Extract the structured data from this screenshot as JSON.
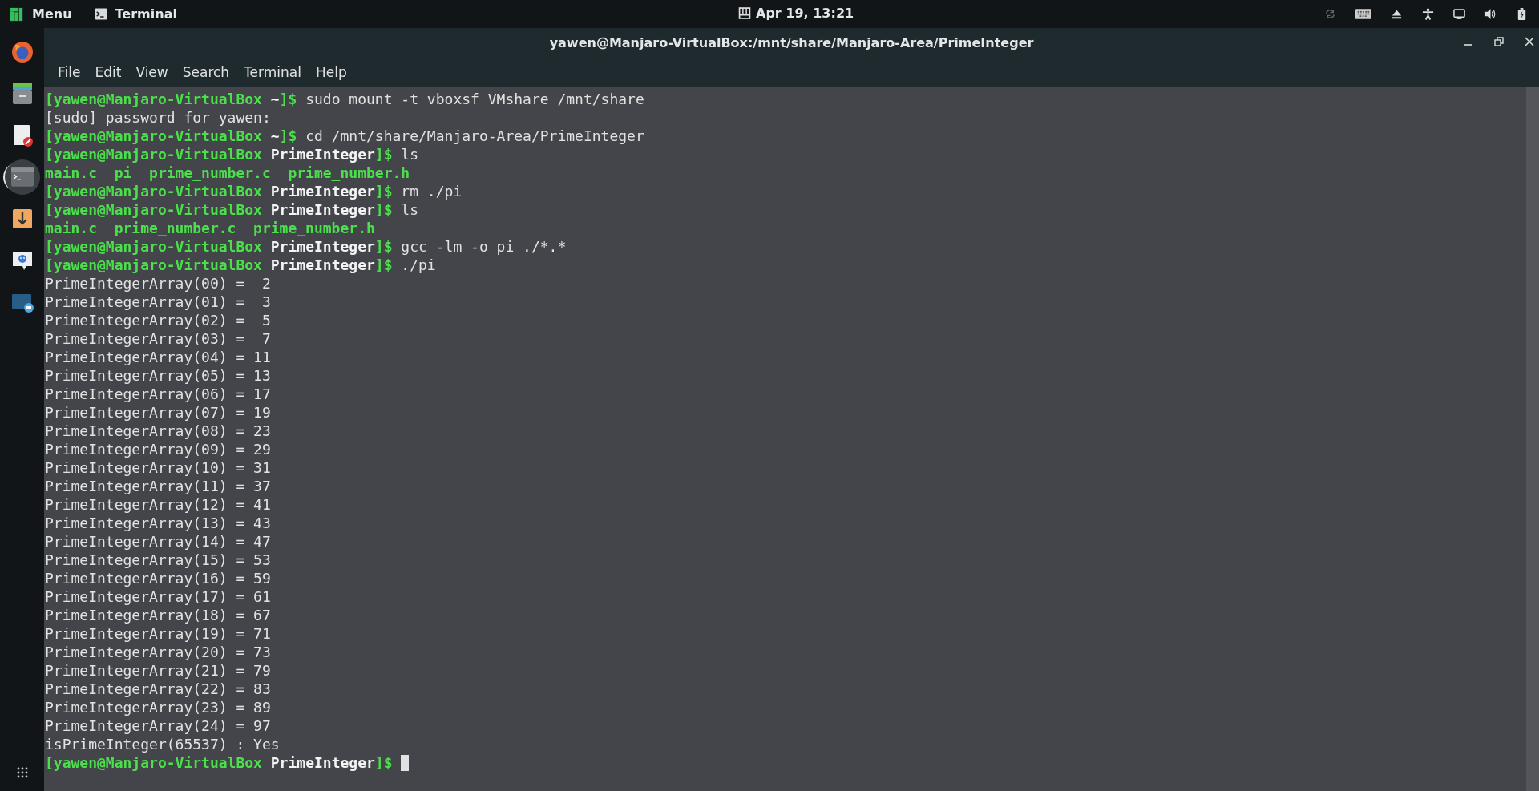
{
  "top_bar": {
    "menu_label": "Menu",
    "app_label": "Terminal",
    "clock": "Apr 19, 13:21"
  },
  "dock": {
    "items": [
      {
        "kind": "browser",
        "selected": false
      },
      {
        "kind": "files",
        "selected": false
      },
      {
        "kind": "editor",
        "selected": false
      },
      {
        "kind": "terminal",
        "selected": true
      },
      {
        "kind": "download",
        "selected": false
      },
      {
        "kind": "chat",
        "selected": false
      },
      {
        "kind": "screenshot",
        "selected": false
      }
    ]
  },
  "window": {
    "title": "yawen@Manjaro-VirtualBox:/mnt/share/Manjaro-Area/PrimeInteger"
  },
  "menu_bar": [
    "File",
    "Edit",
    "View",
    "Search",
    "Terminal",
    "Help"
  ],
  "terminal": {
    "lines": [
      {
        "kind": "prompt",
        "user": "[yawen@Manjaro-VirtualBox",
        "dir": "~",
        "end": "]$",
        "command": "sudo mount -t vboxsf VMshare /mnt/share"
      },
      {
        "kind": "plain",
        "text": "[sudo] password for yawen:"
      },
      {
        "kind": "prompt",
        "user": "[yawen@Manjaro-VirtualBox",
        "dir": "~",
        "end": "]$",
        "command": "cd /mnt/share/Manjaro-Area/PrimeInteger"
      },
      {
        "kind": "prompt",
        "user": "[yawen@Manjaro-VirtualBox",
        "dir": "PrimeInteger",
        "end": "]$",
        "command": "ls"
      },
      {
        "kind": "listing",
        "text": "main.c  pi  prime_number.c  prime_number.h"
      },
      {
        "kind": "prompt",
        "user": "[yawen@Manjaro-VirtualBox",
        "dir": "PrimeInteger",
        "end": "]$",
        "command": "rm ./pi"
      },
      {
        "kind": "prompt",
        "user": "[yawen@Manjaro-VirtualBox",
        "dir": "PrimeInteger",
        "end": "]$",
        "command": "ls"
      },
      {
        "kind": "listing",
        "text": "main.c  prime_number.c  prime_number.h"
      },
      {
        "kind": "prompt",
        "user": "[yawen@Manjaro-VirtualBox",
        "dir": "PrimeInteger",
        "end": "]$",
        "command": "gcc -lm -o pi ./*.*"
      },
      {
        "kind": "prompt",
        "user": "[yawen@Manjaro-VirtualBox",
        "dir": "PrimeInteger",
        "end": "]$",
        "command": "./pi"
      },
      {
        "kind": "plain",
        "text": "PrimeIntegerArray(00) =  2"
      },
      {
        "kind": "plain",
        "text": "PrimeIntegerArray(01) =  3"
      },
      {
        "kind": "plain",
        "text": "PrimeIntegerArray(02) =  5"
      },
      {
        "kind": "plain",
        "text": "PrimeIntegerArray(03) =  7"
      },
      {
        "kind": "plain",
        "text": "PrimeIntegerArray(04) = 11"
      },
      {
        "kind": "plain",
        "text": "PrimeIntegerArray(05) = 13"
      },
      {
        "kind": "plain",
        "text": "PrimeIntegerArray(06) = 17"
      },
      {
        "kind": "plain",
        "text": "PrimeIntegerArray(07) = 19"
      },
      {
        "kind": "plain",
        "text": "PrimeIntegerArray(08) = 23"
      },
      {
        "kind": "plain",
        "text": "PrimeIntegerArray(09) = 29"
      },
      {
        "kind": "plain",
        "text": "PrimeIntegerArray(10) = 31"
      },
      {
        "kind": "plain",
        "text": "PrimeIntegerArray(11) = 37"
      },
      {
        "kind": "plain",
        "text": "PrimeIntegerArray(12) = 41"
      },
      {
        "kind": "plain",
        "text": "PrimeIntegerArray(13) = 43"
      },
      {
        "kind": "plain",
        "text": "PrimeIntegerArray(14) = 47"
      },
      {
        "kind": "plain",
        "text": "PrimeIntegerArray(15) = 53"
      },
      {
        "kind": "plain",
        "text": "PrimeIntegerArray(16) = 59"
      },
      {
        "kind": "plain",
        "text": "PrimeIntegerArray(17) = 61"
      },
      {
        "kind": "plain",
        "text": "PrimeIntegerArray(18) = 67"
      },
      {
        "kind": "plain",
        "text": "PrimeIntegerArray(19) = 71"
      },
      {
        "kind": "plain",
        "text": "PrimeIntegerArray(20) = 73"
      },
      {
        "kind": "plain",
        "text": "PrimeIntegerArray(21) = 79"
      },
      {
        "kind": "plain",
        "text": "PrimeIntegerArray(22) = 83"
      },
      {
        "kind": "plain",
        "text": "PrimeIntegerArray(23) = 89"
      },
      {
        "kind": "plain",
        "text": "PrimeIntegerArray(24) = 97"
      },
      {
        "kind": "plain",
        "text": "isPrimeInteger(65537) : Yes"
      },
      {
        "kind": "prompt",
        "user": "[yawen@Manjaro-VirtualBox",
        "dir": "PrimeInteger",
        "end": "]$",
        "cursor": true
      }
    ]
  }
}
